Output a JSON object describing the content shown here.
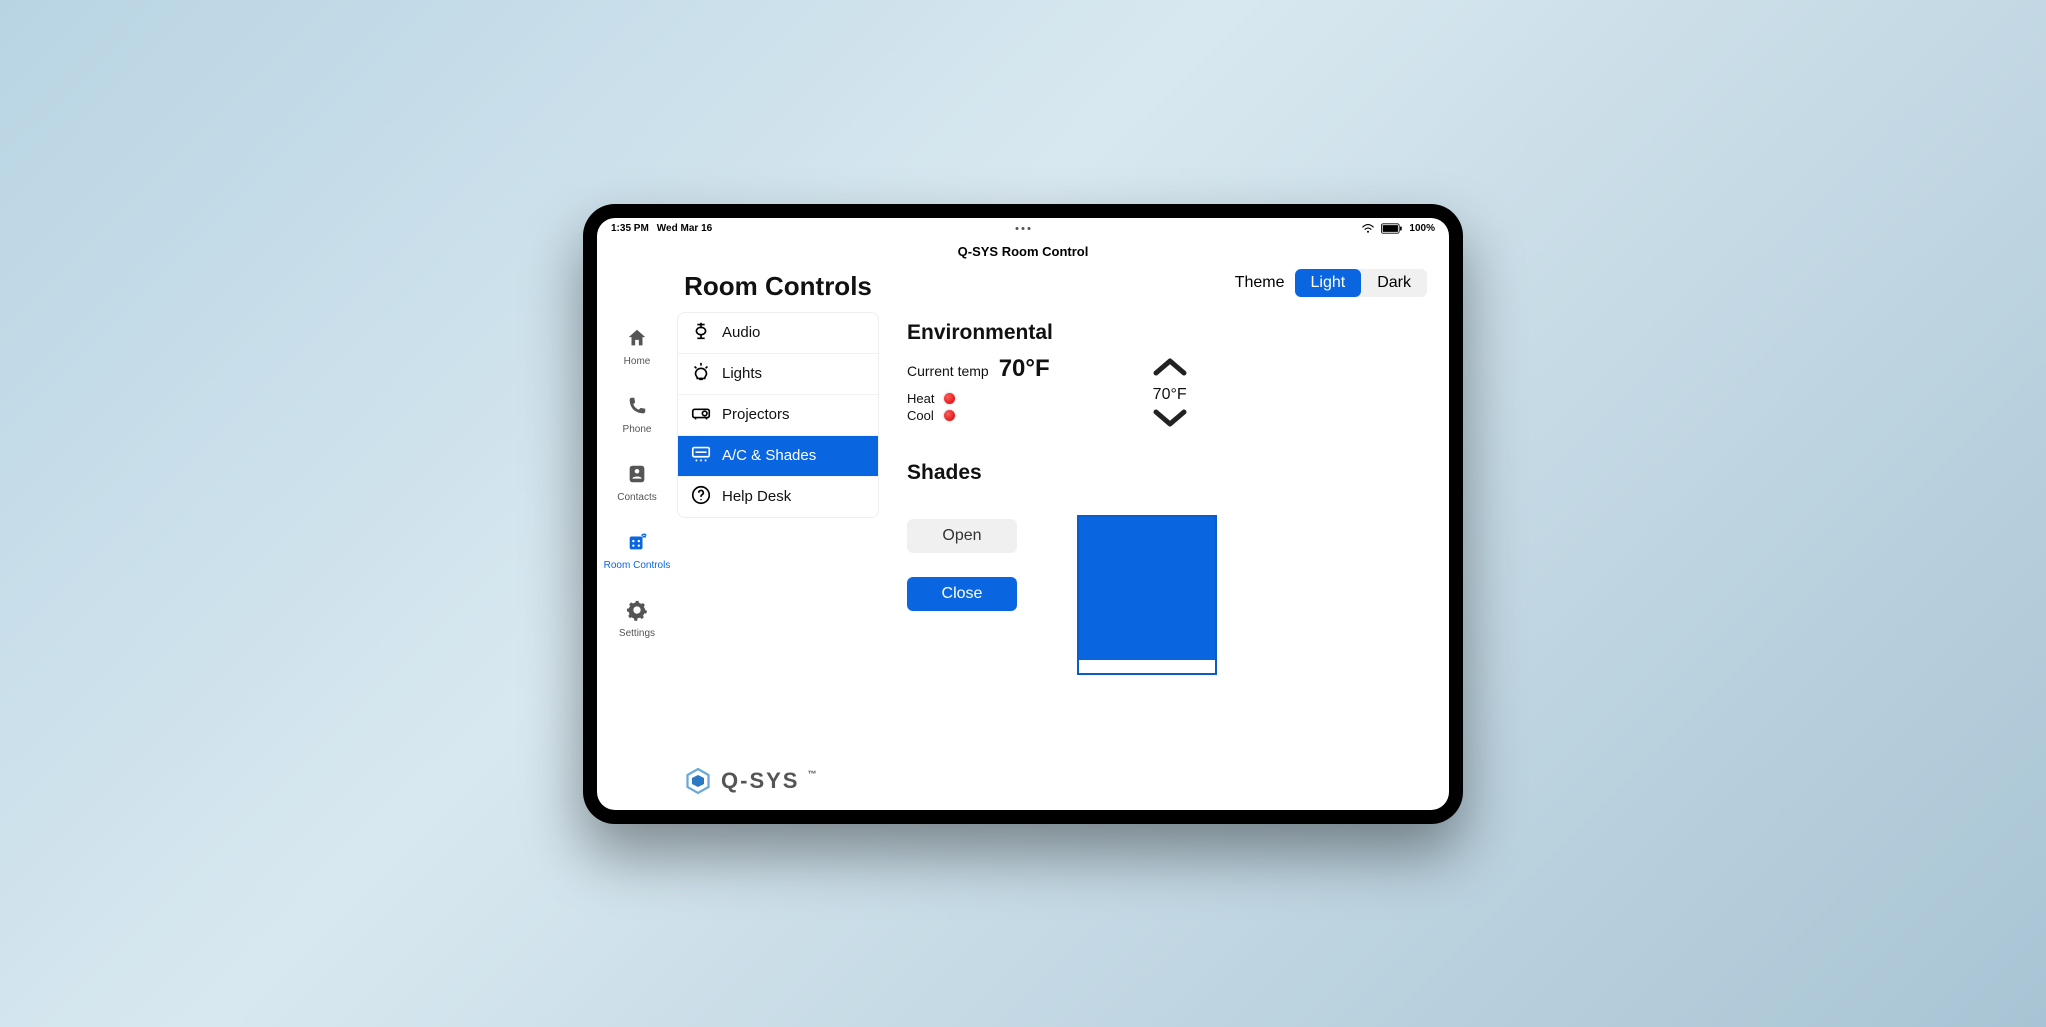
{
  "statusbar": {
    "time": "1:35 PM",
    "date": "Wed Mar 16",
    "battery": "100%"
  },
  "app": {
    "title": "Q-SYS Room Control"
  },
  "nav": {
    "items": [
      {
        "label": "Home"
      },
      {
        "label": "Phone"
      },
      {
        "label": "Contacts"
      },
      {
        "label": "Room Controls"
      },
      {
        "label": "Settings"
      }
    ],
    "active_index": 3
  },
  "panel": {
    "title": "Room Controls",
    "menu": [
      {
        "label": "Audio"
      },
      {
        "label": "Lights"
      },
      {
        "label": "Projectors"
      },
      {
        "label": "A/C & Shades"
      },
      {
        "label": "Help Desk"
      }
    ],
    "active_index": 3
  },
  "logo": {
    "text": "Q-SYS"
  },
  "theme": {
    "label": "Theme",
    "light": "Light",
    "dark": "Dark",
    "active": "Light"
  },
  "environmental": {
    "title": "Environmental",
    "current_label": "Current temp",
    "current_value": "70°F",
    "heat_label": "Heat",
    "cool_label": "Cool",
    "setpoint": "70°F"
  },
  "shades": {
    "title": "Shades",
    "open": "Open",
    "close": "Close",
    "position_percent": 92
  }
}
